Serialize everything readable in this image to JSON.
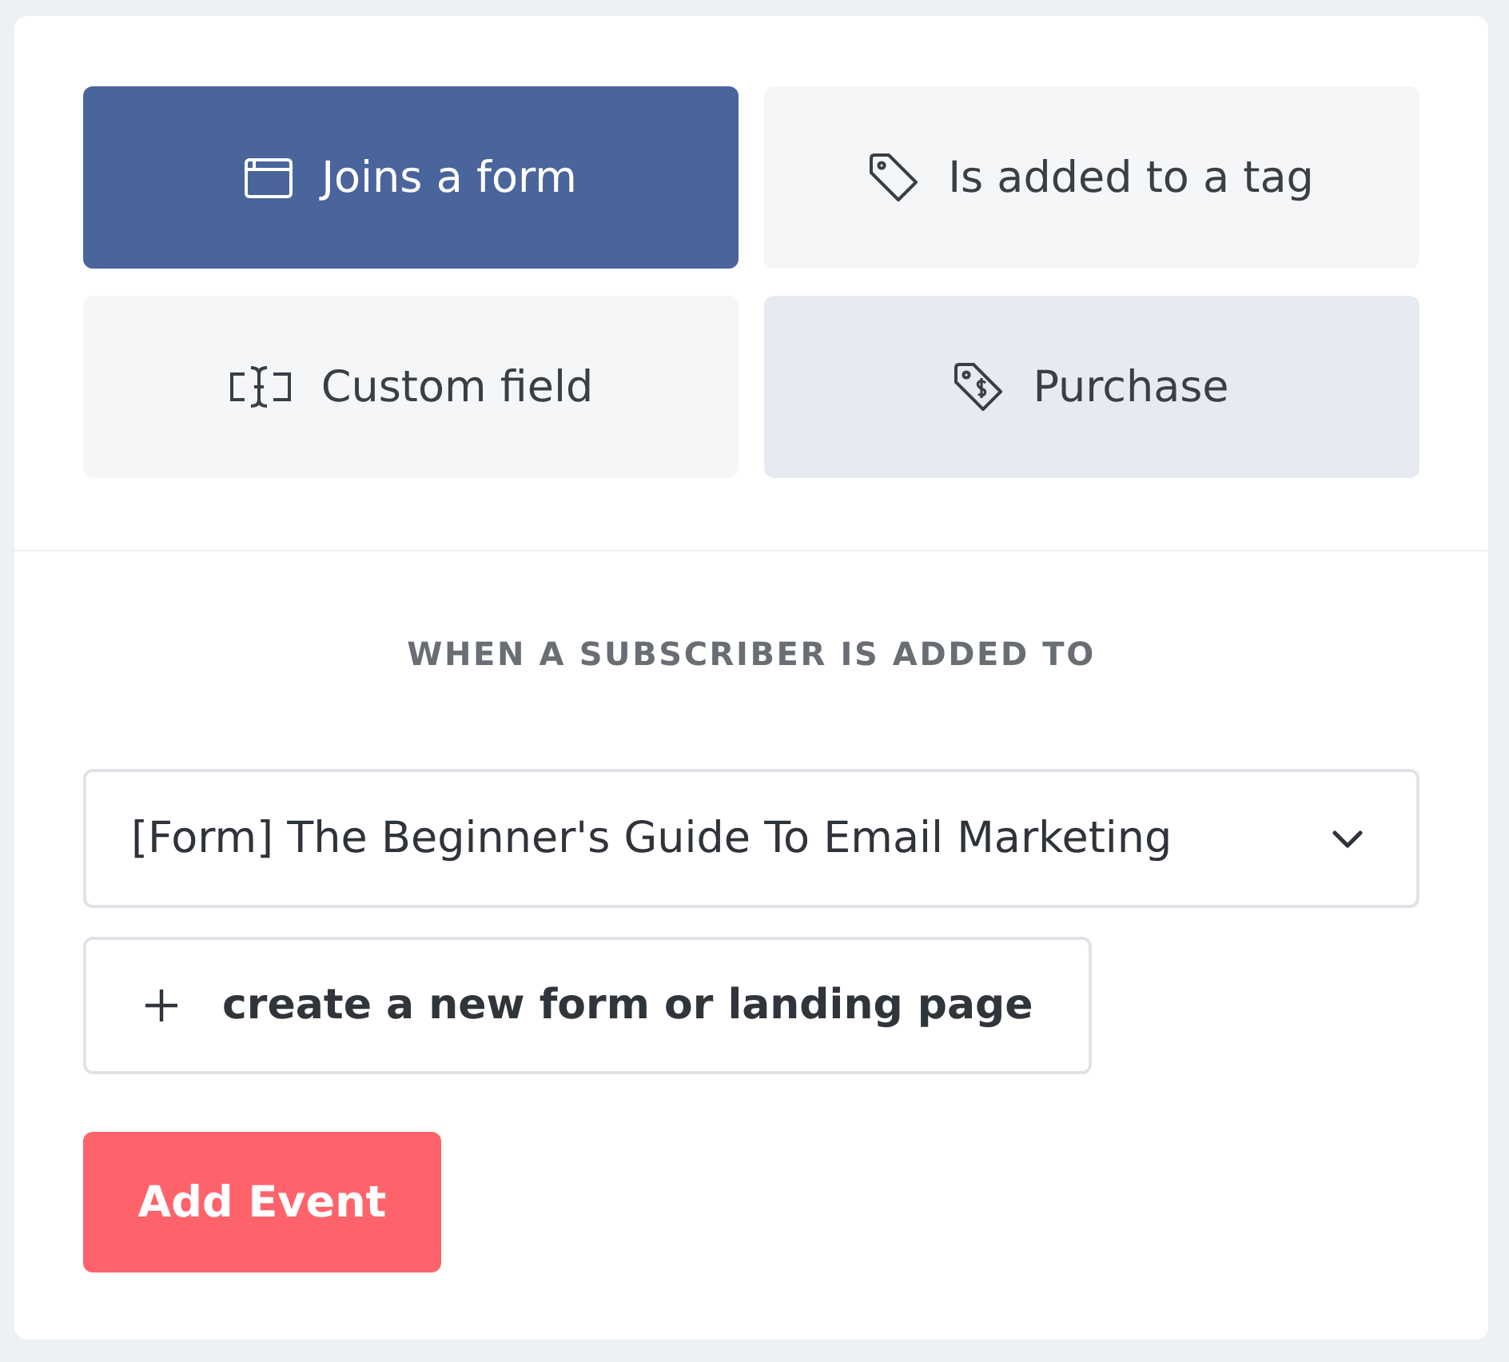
{
  "triggers": [
    {
      "kind": "form",
      "label": "Joins a form",
      "selected": true,
      "hovered": false
    },
    {
      "kind": "tag",
      "label": "Is added to a tag",
      "selected": false,
      "hovered": false
    },
    {
      "kind": "field",
      "label": "Custom field",
      "selected": false,
      "hovered": false
    },
    {
      "kind": "purchase",
      "label": "Purchase",
      "selected": false,
      "hovered": true
    }
  ],
  "section_heading": "WHEN A SUBSCRIBER IS ADDED TO",
  "form_select": {
    "value": "[Form] The Beginner's Guide To Email Marketing"
  },
  "create_button": {
    "label": "create a new form or landing page"
  },
  "submit_button": {
    "label": "Add Event"
  }
}
